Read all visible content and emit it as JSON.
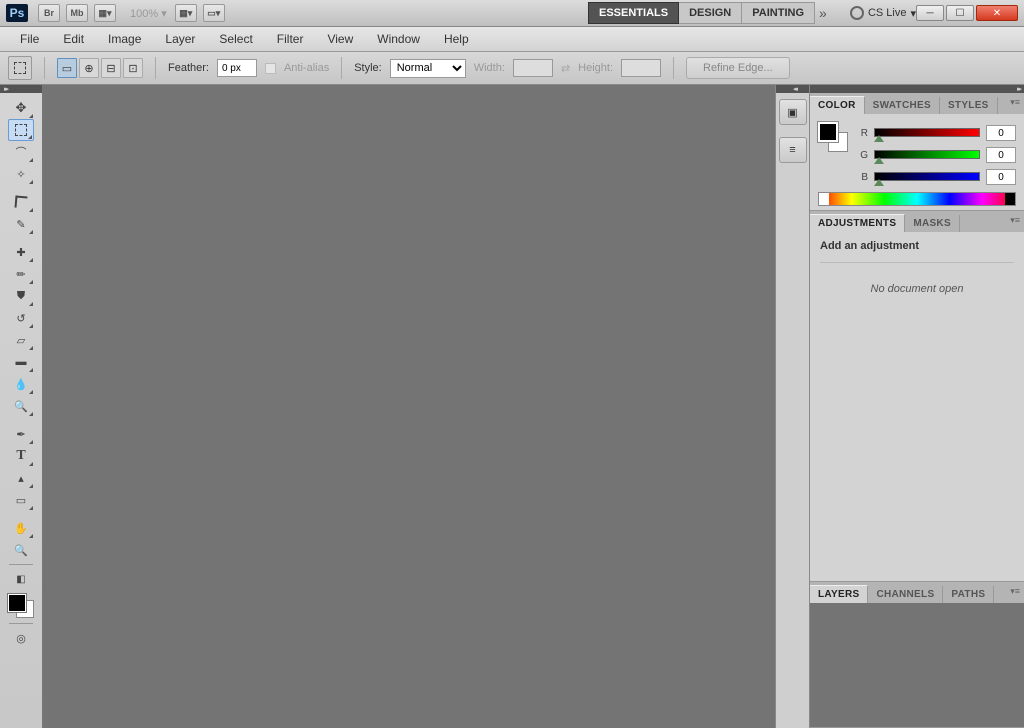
{
  "app": {
    "logo": "Ps",
    "br": "Br",
    "mb": "Mb",
    "zoom": "100%"
  },
  "workspaces": {
    "essentials": "ESSENTIALS",
    "design": "DESIGN",
    "painting": "PAINTING"
  },
  "cslive": "CS Live",
  "menu": [
    "File",
    "Edit",
    "Image",
    "Layer",
    "Select",
    "Filter",
    "View",
    "Window",
    "Help"
  ],
  "options": {
    "feather_label": "Feather:",
    "feather_value": "0 px",
    "antialias": "Anti-alias",
    "style_label": "Style:",
    "style_value": "Normal",
    "width_label": "Width:",
    "height_label": "Height:",
    "refine": "Refine Edge..."
  },
  "color_panel": {
    "tabs": {
      "color": "COLOR",
      "swatches": "SWATCHES",
      "styles": "STYLES"
    },
    "r": {
      "label": "R",
      "value": "0"
    },
    "g": {
      "label": "G",
      "value": "0"
    },
    "b": {
      "label": "B",
      "value": "0"
    }
  },
  "adjustments_panel": {
    "tabs": {
      "adjustments": "ADJUSTMENTS",
      "masks": "MASKS"
    },
    "title": "Add an adjustment",
    "empty": "No document open"
  },
  "layers_panel": {
    "tabs": {
      "layers": "LAYERS",
      "channels": "CHANNELS",
      "paths": "PATHS"
    }
  }
}
